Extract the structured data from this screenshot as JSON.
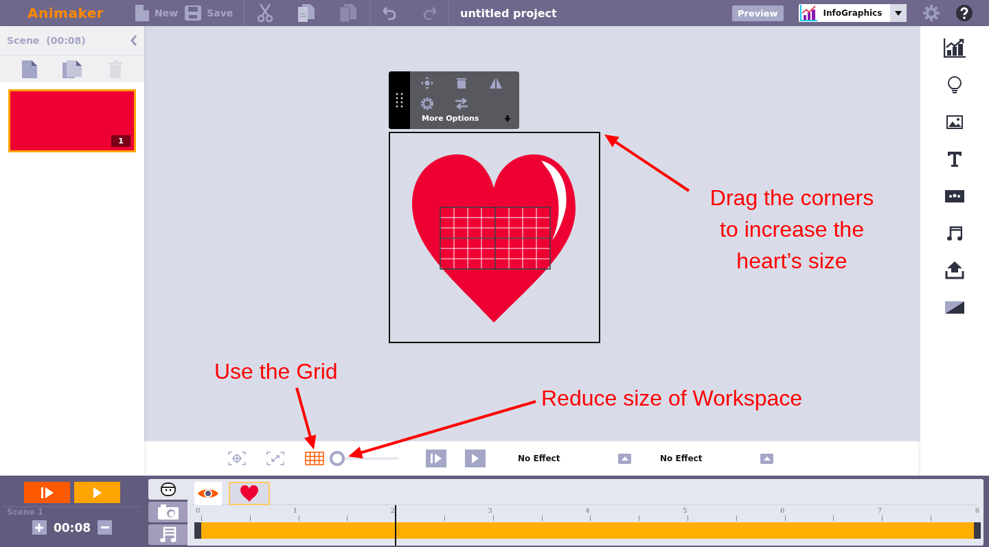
{
  "topbar": {
    "logo": "Animaker",
    "file_buttons": [
      {
        "label": "New",
        "kind": "new"
      },
      {
        "label": "Save",
        "kind": "save"
      }
    ],
    "edit_tools": [
      {
        "kind": "cut",
        "disabled": false
      },
      {
        "kind": "copy",
        "disabled": false
      },
      {
        "kind": "paste",
        "disabled": true
      }
    ],
    "history": [
      {
        "kind": "undo",
        "disabled": false
      },
      {
        "kind": "redo",
        "disabled": true
      }
    ],
    "title": "untitled project",
    "preview": "Preview",
    "category": "InfoGraphics"
  },
  "scene_panel": {
    "title": "Scene",
    "duration": "(00:08)",
    "actions": [
      {
        "kind": "add",
        "disabled": false
      },
      {
        "kind": "duplicate",
        "disabled": false
      },
      {
        "kind": "delete",
        "disabled": true
      }
    ],
    "scenes": [
      {
        "number": "1",
        "selected": true
      }
    ]
  },
  "object_menu": {
    "label": "More Options"
  },
  "workspace_bar": {
    "grid_on": true,
    "zoom": {
      "level": 0
    },
    "effects": [
      {
        "label": "No Effect"
      },
      {
        "label": "No Effect"
      }
    ]
  },
  "right_tools": [
    {
      "kind": "chart"
    },
    {
      "kind": "bulb"
    },
    {
      "kind": "image"
    },
    {
      "kind": "text"
    },
    {
      "kind": "banner"
    },
    {
      "kind": "music"
    },
    {
      "kind": "upload"
    },
    {
      "kind": "background"
    }
  ],
  "timeline": {
    "scene_label": "Scene 1",
    "duration": "00:08",
    "tabs": [
      {
        "kind": "character",
        "selected": true
      },
      {
        "kind": "camera",
        "selected": false
      },
      {
        "kind": "music",
        "selected": false
      }
    ],
    "items": [
      {
        "kind": "eye",
        "selected": false
      },
      {
        "kind": "heart",
        "selected": true
      }
    ],
    "ruler": [
      "0",
      "1",
      "2",
      "3",
      "4",
      "5",
      "6",
      "7",
      "8"
    ],
    "playhead": {
      "level": 0.246
    }
  },
  "annotations": [
    {
      "kind": "corners",
      "text": "Drag the corners to increase the heart’s size"
    },
    {
      "kind": "grid",
      "text": "Use the Grid"
    },
    {
      "kind": "zoom",
      "text": "Reduce size of Workspace"
    }
  ]
}
